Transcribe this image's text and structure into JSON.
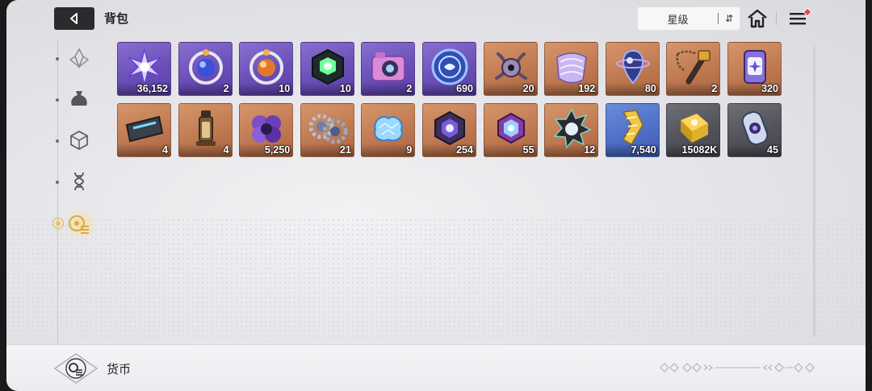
{
  "header": {
    "title": "背包",
    "sort_label": "星级",
    "sort_toggle_glyph": "⇵"
  },
  "colors": {
    "purple": "#6a4fb8",
    "orange": "#c07a52",
    "blue": "#4e6fc6",
    "gray": "#52535a",
    "active_accent": "#f0c04a"
  },
  "sidebar": {
    "items": [
      {
        "icon": "crystal-icon",
        "active": false
      },
      {
        "icon": "pouch-icon",
        "active": false
      },
      {
        "icon": "cube-icon",
        "active": false
      },
      {
        "icon": "dna-icon",
        "active": false
      },
      {
        "icon": "currency-icon",
        "active": true
      }
    ]
  },
  "items": [
    {
      "rarity": "purple",
      "icon": "star-crystal-icon",
      "qty": "36,152"
    },
    {
      "rarity": "purple",
      "icon": "orb-ring-blue-icon",
      "qty": "2"
    },
    {
      "rarity": "purple",
      "icon": "orb-ring-orange-icon",
      "qty": "10"
    },
    {
      "rarity": "purple",
      "icon": "green-cube-icon",
      "qty": "10"
    },
    {
      "rarity": "purple",
      "icon": "camera-icon",
      "qty": "2"
    },
    {
      "rarity": "purple",
      "icon": "blue-coin-icon",
      "qty": "690"
    },
    {
      "rarity": "orange",
      "icon": "tentacle-orb-icon",
      "qty": "20"
    },
    {
      "rarity": "orange",
      "icon": "scroll-ribbon-icon",
      "qty": "192"
    },
    {
      "rarity": "orange",
      "icon": "planet-capsule-icon",
      "qty": "80"
    },
    {
      "rarity": "orange",
      "icon": "key-chain-icon",
      "qty": "2"
    },
    {
      "rarity": "orange",
      "icon": "canister-icon",
      "qty": "320"
    },
    {
      "rarity": "orange",
      "icon": "blade-chip-icon",
      "qty": "4"
    },
    {
      "rarity": "orange",
      "icon": "vial-icon",
      "qty": "4"
    },
    {
      "rarity": "orange",
      "icon": "purple-flower-core-icon",
      "qty": "5,250"
    },
    {
      "rarity": "orange",
      "icon": "twin-gears-icon",
      "qty": "21"
    },
    {
      "rarity": "orange",
      "icon": "brain-net-icon",
      "qty": "9"
    },
    {
      "rarity": "orange",
      "icon": "hex-core-icon",
      "qty": "254"
    },
    {
      "rarity": "orange",
      "icon": "hex-core-small-icon",
      "qty": "55"
    },
    {
      "rarity": "orange",
      "icon": "spiked-badge-icon",
      "qty": "12"
    },
    {
      "rarity": "blue",
      "icon": "gold-ribbon-icon",
      "qty": "7,540"
    },
    {
      "rarity": "gray",
      "icon": "gold-plate-icon",
      "qty": "15082K"
    },
    {
      "rarity": "gray",
      "icon": "energy-capsule-icon",
      "qty": "45"
    }
  ],
  "footer": {
    "label": "货币"
  }
}
